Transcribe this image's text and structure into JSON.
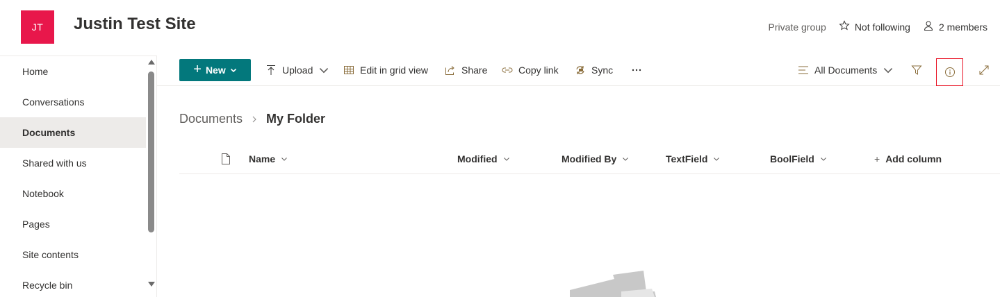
{
  "header": {
    "logo_initials": "JT",
    "site_title": "Justin Test Site",
    "private_group": "Private group",
    "follow_label": "Not following",
    "members_label": "2 members",
    "logo_color": "#e8174b"
  },
  "nav": {
    "items": [
      {
        "label": "Home"
      },
      {
        "label": "Conversations"
      },
      {
        "label": "Documents",
        "active": true
      },
      {
        "label": "Shared with us"
      },
      {
        "label": "Notebook"
      },
      {
        "label": "Pages"
      },
      {
        "label": "Site contents"
      },
      {
        "label": "Recycle bin"
      }
    ]
  },
  "commands": {
    "new_label": "New",
    "upload_label": "Upload",
    "grid_label": "Edit in grid view",
    "share_label": "Share",
    "copy_link_label": "Copy link",
    "sync_label": "Sync",
    "view_label": "All Documents",
    "accent_color": "#03787c"
  },
  "breadcrumb": {
    "root": "Documents",
    "current": "My Folder"
  },
  "columns": {
    "name": "Name",
    "modified": "Modified",
    "modified_by": "Modified By",
    "text_field": "TextField",
    "bool_field": "BoolField",
    "add_column": "Add column"
  }
}
